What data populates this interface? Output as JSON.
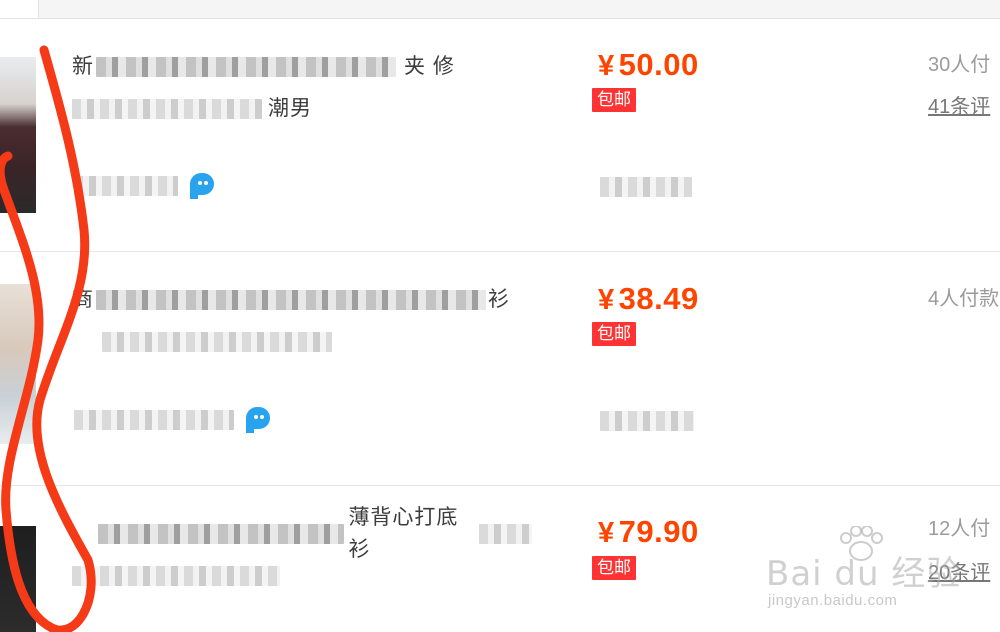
{
  "items": [
    {
      "title_line1_tail": "夹 修",
      "title_line1_prefix": "新",
      "title_line2_tail": "潮男",
      "price_symbol": "¥",
      "price": "50.00",
      "badge": "包邮",
      "sales": "30人付",
      "comments": "41条评"
    },
    {
      "title_line1_prefix": "商",
      "title_line1_tail": "衫",
      "title_line2_tail": "",
      "price_symbol": "¥",
      "price": "38.49",
      "badge": "包邮",
      "sales": "4人付款",
      "comments": ""
    },
    {
      "title_line1_prefix": "",
      "title_line1_tail": "薄背心打底衫",
      "title_line2_tail": "",
      "price_symbol": "¥",
      "price": "79.90",
      "badge": "包邮",
      "sales": "12人付",
      "comments": "20条评"
    }
  ],
  "watermark": {
    "brand": "Bai du 经验",
    "url": "jingyan.baidu.com"
  },
  "colors": {
    "price": "#ff4400",
    "badge_bg": "#ff3333",
    "annotation": "#f43a17",
    "wangwang_icon": "#2aa3ef"
  },
  "icons": {
    "chat": "wangwang-chat-icon"
  }
}
